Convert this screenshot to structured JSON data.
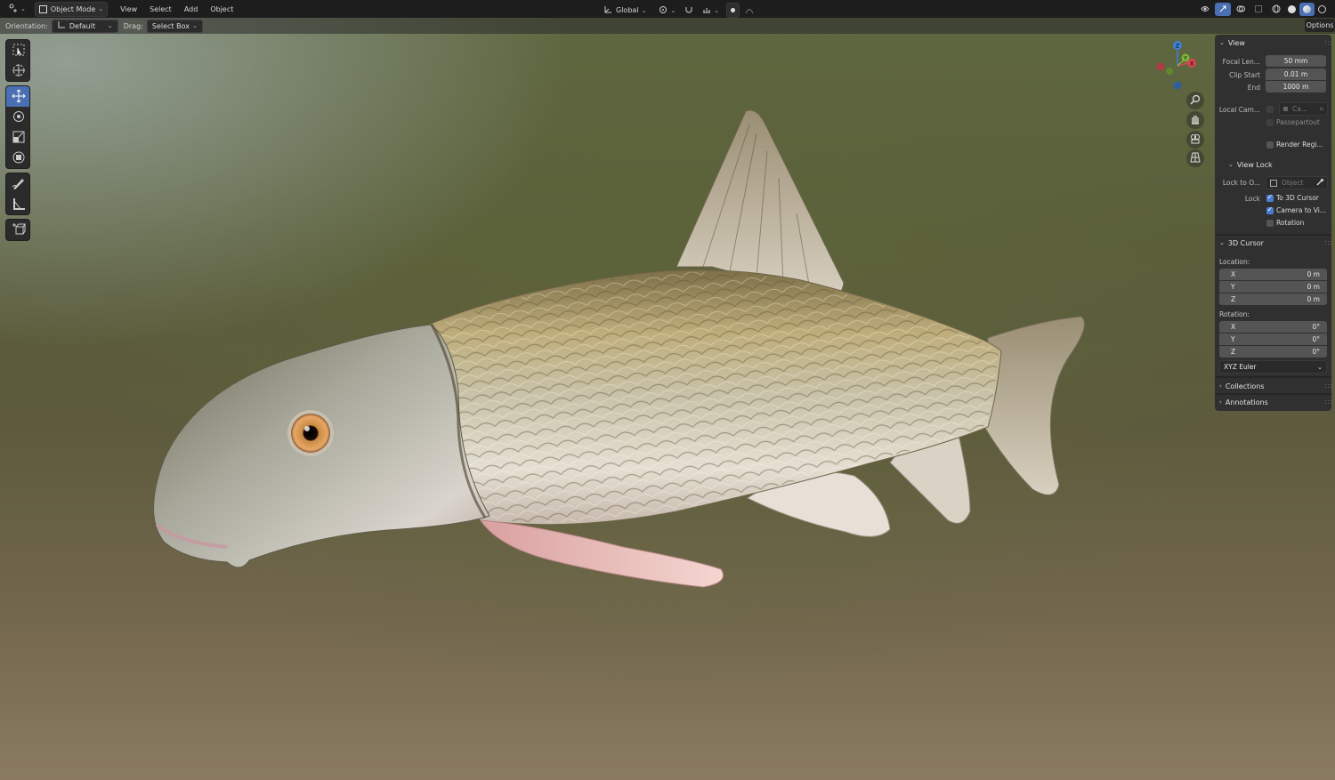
{
  "header": {
    "mode": "Object Mode",
    "menus": [
      "View",
      "Select",
      "Add",
      "Object"
    ],
    "transform_orientation": "Global"
  },
  "tool_settings": {
    "orientation_label": "Orientation:",
    "orientation_value": "Default",
    "drag_label": "Drag:",
    "drag_value": "Select Box",
    "options_label": "Options"
  },
  "gizmo": {
    "z": "Z",
    "y": "Y",
    "x": "X"
  },
  "sidebar": {
    "view": {
      "title": "View",
      "focal_label": "Focal Len...",
      "focal_value": "50 mm",
      "clip_start_label": "Clip Start",
      "clip_start_value": "0.01 m",
      "end_label": "End",
      "end_value": "1000 m",
      "local_camera_label": "Local Cam...",
      "local_camera_value": "Ca...",
      "passepartout": "Passepartout",
      "render_region": "Render Regi..."
    },
    "view_lock": {
      "title": "View Lock",
      "lock_to_label": "Lock to O...",
      "lock_to_placeholder": "Object",
      "lock_label": "Lock",
      "to_cursor": "To 3D Cursor",
      "camera_to_view": "Camera to Vi...",
      "rotation": "Rotation"
    },
    "cursor": {
      "title": "3D Cursor",
      "location_label": "Location:",
      "location": [
        {
          "axis": "X",
          "value": "0 m"
        },
        {
          "axis": "Y",
          "value": "0 m"
        },
        {
          "axis": "Z",
          "value": "0 m"
        }
      ],
      "rotation_label": "Rotation:",
      "rotation": [
        {
          "axis": "X",
          "value": "0°"
        },
        {
          "axis": "Y",
          "value": "0°"
        },
        {
          "axis": "Z",
          "value": "0°"
        }
      ],
      "rotation_mode": "XYZ Euler"
    },
    "collections": "Collections",
    "annotations": "Annotations"
  },
  "colors": {
    "accent": "#4a7cd1",
    "active_tool": "#4a6fb2",
    "gizmo_x": "#d64550",
    "gizmo_y": "#7fb53a",
    "gizmo_z": "#3e7fd6"
  }
}
